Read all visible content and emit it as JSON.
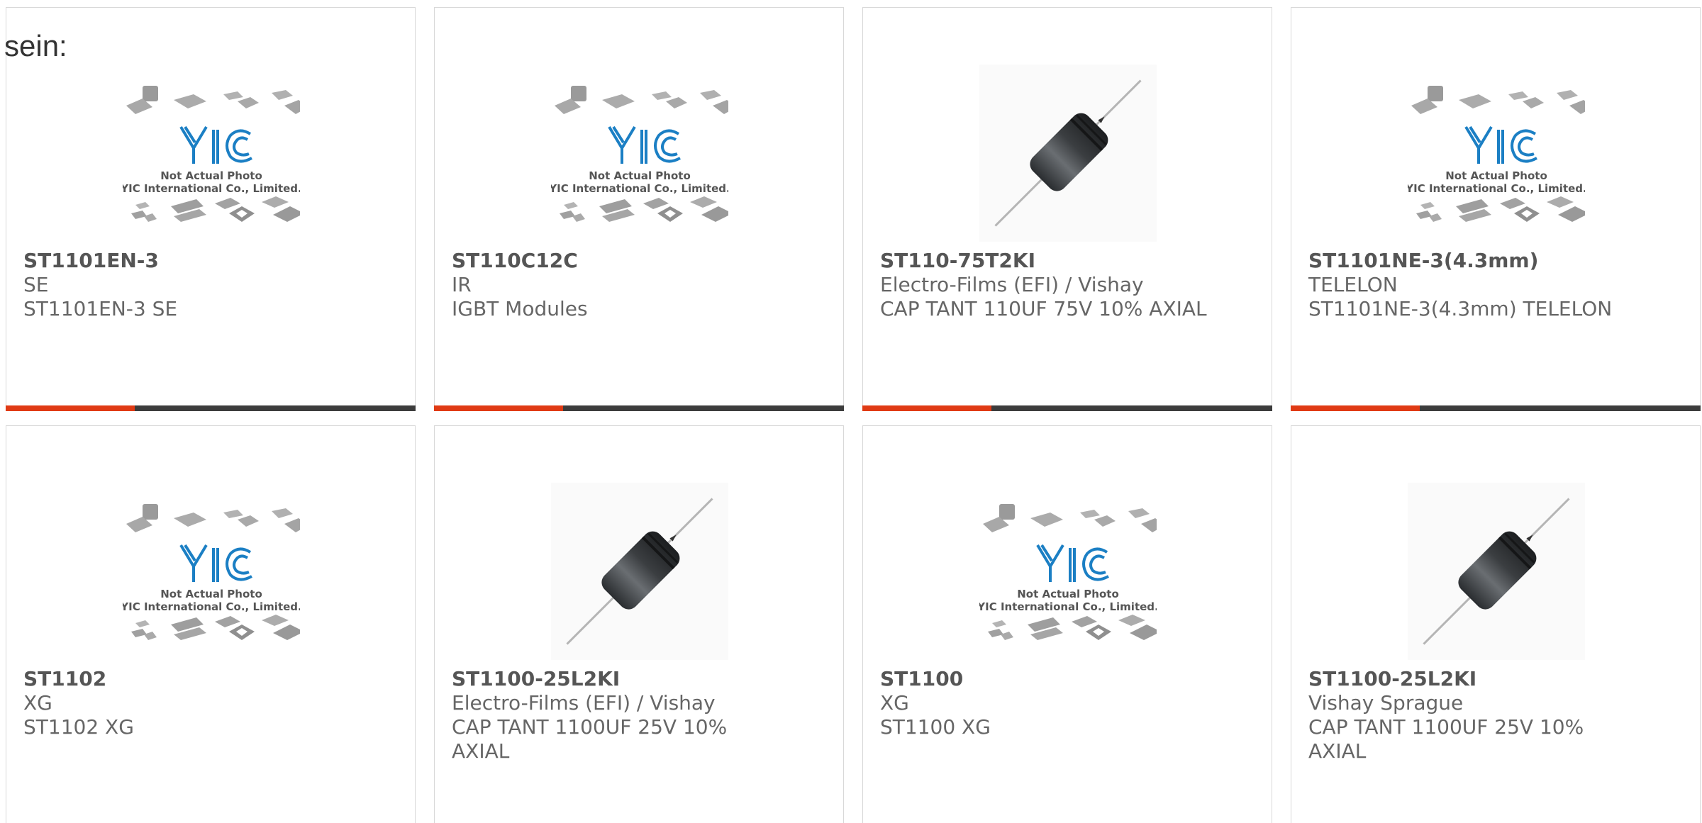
{
  "heading": "sein:",
  "placeholder": {
    "logo_text": "YIC",
    "line1": "Not Actual Photo",
    "line2": "YIC International Co., Limited."
  },
  "colors": {
    "accent": "#e03a14",
    "bar": "#3c3c3c",
    "logo_blue": "#1b7fc4"
  },
  "products": [
    {
      "part": "ST1101EN-3",
      "manufacturer": "SE",
      "description": "ST1101EN-3 SE",
      "image": "placeholder"
    },
    {
      "part": "ST110C12C",
      "manufacturer": "IR",
      "description": "IGBT Modules",
      "image": "placeholder"
    },
    {
      "part": "ST110-75T2KI",
      "manufacturer": "Electro-Films (EFI) / Vishay",
      "description": "CAP TANT 110UF 75V 10% AXIAL",
      "image": "capacitor"
    },
    {
      "part": "ST1101NE-3(4.3mm)",
      "manufacturer": "TELELON",
      "description": "ST1101NE-3(4.3mm) TELELON",
      "image": "placeholder"
    },
    {
      "part": "ST1102",
      "manufacturer": "XG",
      "description": "ST1102 XG",
      "image": "placeholder"
    },
    {
      "part": "ST1100-25L2KI",
      "manufacturer": "Electro-Films (EFI) / Vishay",
      "description_lines": [
        "CAP TANT 1100UF 25V 10%",
        "AXIAL"
      ],
      "image": "capacitor"
    },
    {
      "part": "ST1100",
      "manufacturer": "XG",
      "description": "ST1100 XG",
      "image": "placeholder"
    },
    {
      "part": "ST1100-25L2KI",
      "manufacturer": "Vishay Sprague",
      "description_lines": [
        "CAP TANT 1100UF 25V 10%",
        "AXIAL"
      ],
      "image": "capacitor"
    }
  ]
}
